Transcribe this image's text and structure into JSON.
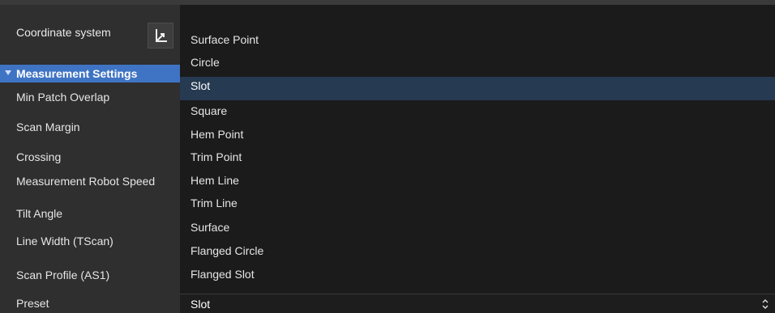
{
  "left_panel": {
    "coordinate_system_label": "Coordinate system",
    "section_title": "Measurement Settings",
    "properties": [
      "Min Patch Overlap",
      "Scan Margin",
      "Crossing",
      "Measurement Robot Speed",
      "Tilt Angle",
      "Line Width (TScan)",
      "Scan Profile (AS1)",
      "Preset"
    ]
  },
  "dropdown": {
    "options": [
      "Surface Point",
      "Circle",
      "Slot",
      "Square",
      "Hem Point",
      "Trim Point",
      "Hem Line",
      "Trim Line",
      "Surface",
      "Flanged Circle",
      "Flanged Slot"
    ],
    "highlighted": "Slot",
    "selected_value": "Slot"
  },
  "icons": {
    "coordinate_button": "axes-icon",
    "section_toggle": "triangle-down-icon",
    "select_arrows": "up-down-arrows-icon"
  },
  "colors": {
    "section_header": "#3f74c4",
    "highlight": "#263a51"
  }
}
